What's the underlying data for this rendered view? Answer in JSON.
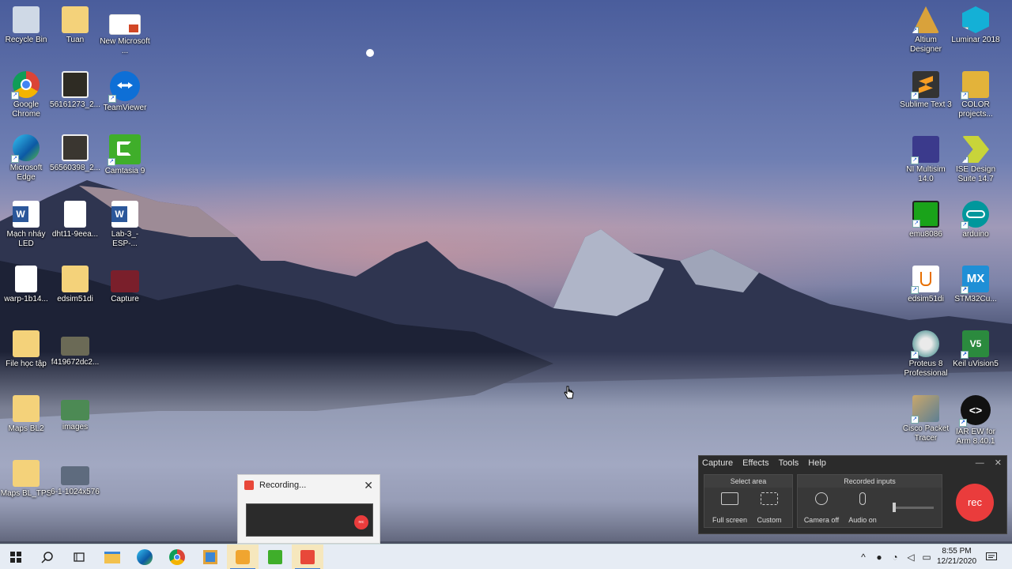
{
  "desktop": {
    "icons": [
      {
        "label": "Recycle Bin"
      },
      {
        "label": "Tuan"
      },
      {
        "label": "New Microsoft ..."
      },
      {
        "label": "Google Chrome"
      },
      {
        "label": "56161273_2..."
      },
      {
        "label": "TeamViewer"
      },
      {
        "label": "Microsoft Edge"
      },
      {
        "label": "56560398_2..."
      },
      {
        "label": "Camtasia 9"
      },
      {
        "label": "Mạch nháy LED"
      },
      {
        "label": "dht11-9eea..."
      },
      {
        "label": "Lab-3_-ESP-..."
      },
      {
        "label": "warp-1b14..."
      },
      {
        "label": "edsim51di"
      },
      {
        "label": "Capture"
      },
      {
        "label": "File học tập"
      },
      {
        "label": "f419672dc2..."
      },
      {
        "label": "Maps BL2"
      },
      {
        "label": "images"
      },
      {
        "label": "Maps BL_TPS"
      },
      {
        "label": "6-1-1024x576"
      },
      {
        "label": "Altium Designer"
      },
      {
        "label": "Luminar 2018"
      },
      {
        "label": "Sublime Text 3"
      },
      {
        "label": "COLOR projects..."
      },
      {
        "label": "NI Multisim 14.0"
      },
      {
        "label": "ISE Design Suite 14.7"
      },
      {
        "label": "emu8086"
      },
      {
        "label": "arduino"
      },
      {
        "label": "edsim51di"
      },
      {
        "label": "STM32Cu..."
      },
      {
        "label": "Proteus 8 Professional"
      },
      {
        "label": "Keil uVision5"
      },
      {
        "label": "Cisco Packet Tracer"
      },
      {
        "label": "IAR EW for Arm 8.40.1"
      }
    ]
  },
  "recording_popup": {
    "title": "Recording...",
    "close": "✕",
    "thumb_rec": "rec"
  },
  "recorder": {
    "menu": [
      "Capture",
      "Effects",
      "Tools",
      "Help"
    ],
    "minimize": "—",
    "close": "✕",
    "select_area": "Select area",
    "full_screen": "Full screen",
    "custom": "Custom",
    "recorded_inputs": "Recorded inputs",
    "camera": "Camera off",
    "audio": "Audio on",
    "rec": "rec"
  },
  "taskbar": {
    "time": "8:55 PM",
    "date": "12/21/2020"
  },
  "colors": {
    "accent_red": "#ea3c3c",
    "taskbar_bg": "#e6ecf4"
  }
}
